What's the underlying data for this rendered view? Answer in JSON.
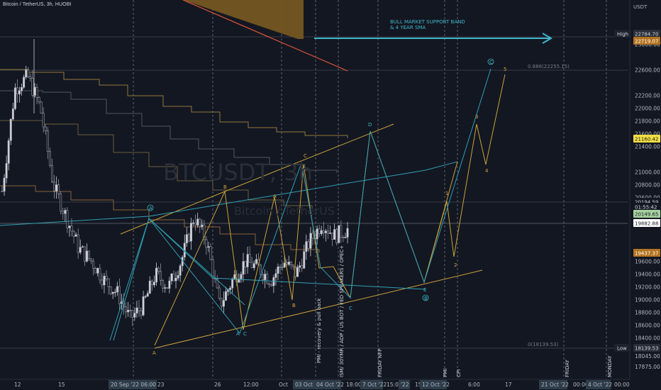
{
  "header": {
    "title": "Bitcoin / TetherUS, 3h, HUOBI"
  },
  "watermark": {
    "symbol": "BTCUSDT, 3h",
    "name": "Bitcoin / TetherUS"
  },
  "axis": {
    "unit": "USDT",
    "y_ticks": [
      "23000.00",
      "22600.00",
      "22200.00",
      "22000.00",
      "21800.00",
      "21600.00",
      "21400.00",
      "21000.00",
      "20800.00",
      "20600.00",
      "20400.00",
      "19600.00",
      "19400.00",
      "19200.00",
      "19000.00",
      "18800.00",
      "18600.00",
      "18400.00",
      "18045.00",
      "17875.00"
    ],
    "x_ticks": [
      "12",
      "15",
      "23",
      "26",
      "12:00",
      "Oct",
      "18:00",
      "15:00",
      "15",
      "6:00",
      "17",
      "00:00",
      "00:00"
    ],
    "x_highlight": [
      "20 Sep '22  06:00",
      "03 Oct '",
      "04 Oct '22",
      "7 Oct '22",
      "'22",
      "12 Oct '22",
      "21 Oct '22",
      "4 Oct '22"
    ]
  },
  "price_badges": {
    "high_label": "High",
    "high": "22784.70",
    "orange": "22719.07",
    "yellow": "21160.42",
    "current": "20194.59",
    "countdown": "01:55:42",
    "green": "20149.65",
    "white": "19882.88",
    "orange2": "19437.37",
    "low_label": "Low",
    "low": "18139.53"
  },
  "annotations": {
    "bull_band": "BULL MARKET SUPPORT BAND",
    "bull_band2": "& 4 YEAR SMA",
    "fib_top": "0.886(22255.15)",
    "fib_bottom": "0(18139.53)",
    "event1": "PMI - recovery & pull back",
    "event2": "ISM/ 30YMR / ADP / US BOT / FED SPEAKERS / OPEC+",
    "event3": "FRIDAY NFP",
    "event4": "PMI",
    "event5": "CPI",
    "event6": "FRIDAY",
    "event7": "MONDAY"
  },
  "wave_labels": {
    "orange": [
      "A",
      "B",
      "A",
      "B",
      "C",
      "1",
      "2",
      "3",
      "4",
      "5"
    ],
    "teal": [
      "A",
      "C",
      "D",
      "E",
      "C"
    ],
    "circled": [
      "A",
      "B",
      "C"
    ]
  },
  "colors": {
    "bg": "#131722",
    "up": "#d1d4dc",
    "teal": "#3fb6c8",
    "orange": "#d9a43a",
    "dashed": "#5d606b"
  },
  "chart_data": {
    "type": "candlestick",
    "title": "Bitcoin / TetherUS, 3h, HUOBI",
    "ylabel": "USDT",
    "ylim": [
      17800,
      23200
    ],
    "x": [
      "12",
      "15",
      "20 Sep '22",
      "23",
      "26",
      "12:00",
      "Oct",
      "03 Oct '",
      "04 Oct '22",
      "18:00",
      "7 Oct '22",
      "15:00",
      "'22",
      "15",
      "12 Oct '22",
      "6:00",
      "17",
      "21 Oct '22",
      "00:00",
      "4 Oct '22",
      "00:00"
    ],
    "close_path": [
      20700,
      22300,
      22500,
      22000,
      20800,
      20300,
      19800,
      19600,
      19300,
      19100,
      18700,
      18900,
      19400,
      19200,
      19600,
      20300,
      19900,
      18900,
      19300,
      19600,
      19500,
      19300,
      19600,
      19400,
      19900,
      20200,
      20000,
      20100
    ],
    "projection": [
      {
        "name": "orange-wave",
        "points": [
          19900,
          21200,
          20700,
          22255
        ]
      },
      {
        "name": "teal-wave",
        "points": [
          18700,
          21350,
          19000,
          22300
        ]
      }
    ],
    "levels": {
      "high": 22784.7,
      "orange": 22719.07,
      "fib_0886": 22255.15,
      "yellow": 21160.42,
      "current": 20194.59,
      "green": 20149.65,
      "white": 19882.88,
      "orange2": 19437.37,
      "fib_0": 18139.53
    }
  }
}
